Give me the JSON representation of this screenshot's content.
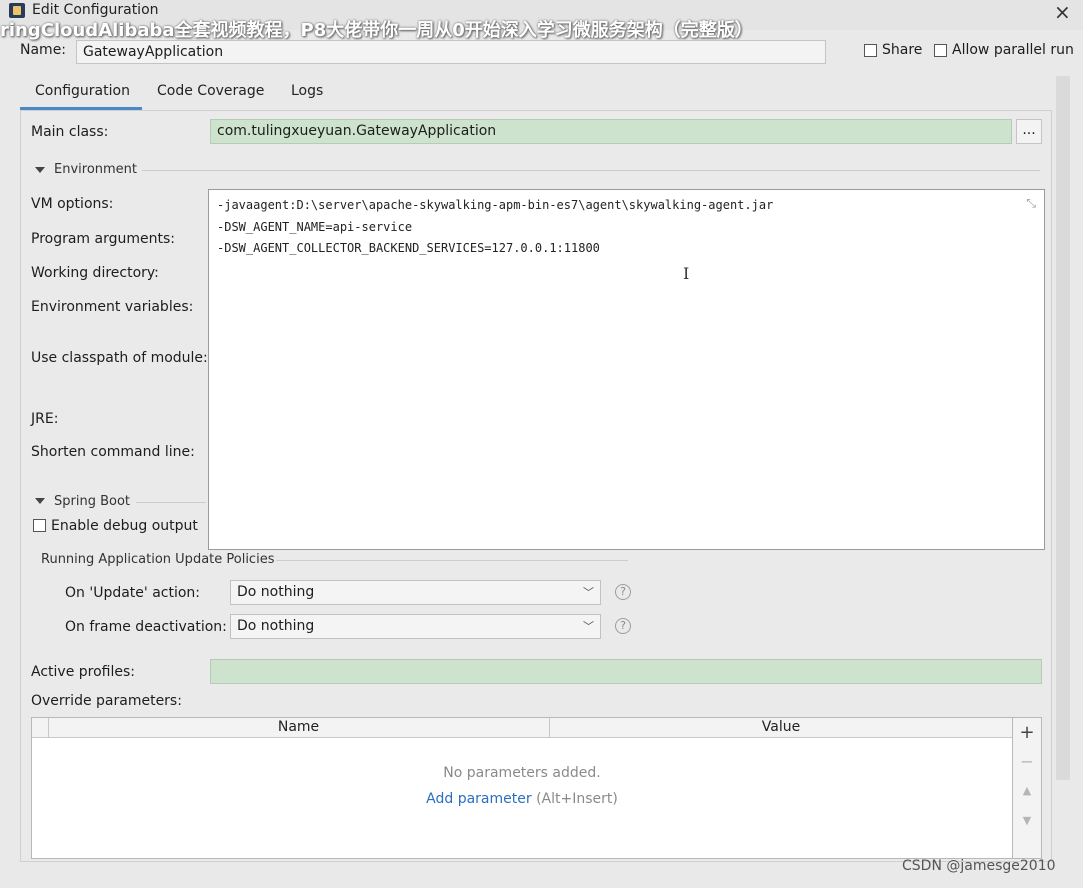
{
  "window": {
    "title": "Edit Configuration",
    "overlay_banner": "ringCloudAlibaba全套视频教程，P8大佬带你一周从0开始深入学习微服务架构（完整版）",
    "close_glyph": "×"
  },
  "header": {
    "name_label": "Name:",
    "name_value": "GatewayApplication",
    "share_label": "Share",
    "parallel_label": "Allow parallel run"
  },
  "tabs": [
    {
      "label": "Configuration",
      "active": true
    },
    {
      "label": "Code Coverage",
      "active": false
    },
    {
      "label": "Logs",
      "active": false
    }
  ],
  "main_class": {
    "label": "Main class:",
    "value": "com.tulingxueyuan.GatewayApplication",
    "browse_label": "..."
  },
  "environment": {
    "section_title": "Environment",
    "labels": {
      "vm_options": "VM options:",
      "program_arguments": "Program arguments:",
      "working_directory": "Working directory:",
      "environment_variables": "Environment variables:",
      "classpath_module": "Use classpath of module:",
      "jre": "JRE:",
      "shorten_command_line": "Shorten command line:"
    },
    "vm_options_lines": [
      "-javaagent:D:\\server\\apache-skywalking-apm-bin-es7\\agent\\skywalking-agent.jar",
      "-DSW_AGENT_NAME=api-service",
      "-DSW_AGENT_COLLECTOR_BACKEND_SERVICES=127.0.0.1:11800"
    ]
  },
  "spring_boot": {
    "section_title": "Spring Boot",
    "debug_label": "Enable debug output",
    "policies_title": "Running Application Update Policies",
    "update_action_label": "On 'Update' action:",
    "update_action_value": "Do nothing",
    "frame_deactivation_label": "On frame deactivation:",
    "frame_deactivation_value": "Do nothing",
    "active_profiles_label": "Active profiles:",
    "active_profiles_value": "",
    "override_label": "Override parameters:"
  },
  "override_table": {
    "columns": [
      "Name",
      "Value"
    ],
    "empty_text": "No parameters added.",
    "add_link": "Add parameter",
    "add_shortcut": "(Alt+Insert)",
    "tools": [
      "+",
      "−",
      "▲",
      "▼"
    ]
  },
  "watermark": "CSDN @jamesge2010",
  "colors": {
    "accent": "#4a88c7",
    "link": "#2a6fc0",
    "green_field": "#cde3cd"
  }
}
